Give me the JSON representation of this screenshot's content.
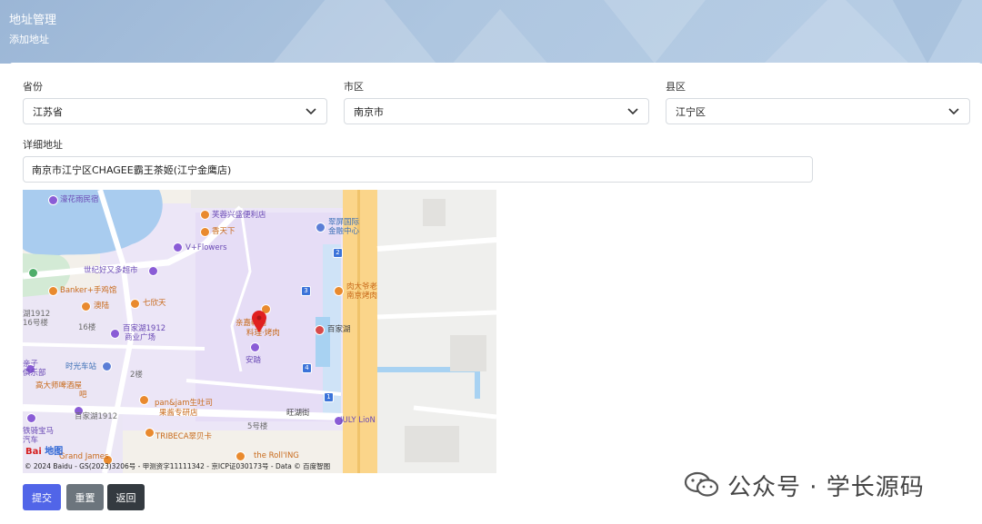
{
  "header": {
    "title": "地址管理",
    "subtitle": "添加地址"
  },
  "form": {
    "province": {
      "label": "省份",
      "value": "江苏省"
    },
    "city": {
      "label": "市区",
      "value": "南京市"
    },
    "district": {
      "label": "县区",
      "value": "江宁区"
    },
    "detail": {
      "label": "详细地址",
      "value": "南京市江宁区CHAGEE霸王茶姬(江宁金鹰店)"
    }
  },
  "map": {
    "copyright": "© 2024 Baidu - GS(2023)3206号 - 甲测资字11111342 - 京ICP证030173号 - Data © 百度智图",
    "logo_text": "Bai",
    "logo_suffix": "地图",
    "labels": {
      "l1": "濠花雨民宿",
      "l2": "芙蓉兴盛便利店",
      "l3": "翠屏国际",
      "l4": "金融中心",
      "l5": "香天下",
      "l6": "V+Flowers",
      "l7": "世纪好又多超市",
      "l8": "Banker+手鸡馆",
      "l9": "七欣天",
      "l10": "肉大爷老",
      "l11": "南京烤肉",
      "l12": "湖1912",
      "l13": "16号楼",
      "l14": "澳陆",
      "l15": "16楼",
      "l16": "百家湖1912",
      "l17": "商业广场",
      "l18": "亲嘉韩国",
      "l19": "料理·烤肉",
      "l20": "百家湖",
      "l21": "安踏",
      "l22": "亲子",
      "l23": "俱乐部",
      "l24": "时光车站",
      "l25": "2楼",
      "l26": "高大师啤酒屋",
      "l27": "吧",
      "l28": "pan&jam生吐司",
      "l29": "果酱专研店",
      "l30": "百家湖1912",
      "l31": "旺湖街",
      "l32": "5号楼",
      "l33": "JULY LioN",
      "l34": "铁骑宝马",
      "l35": "汽车",
      "l36": "TRIBECA翠贝卡",
      "l37": "the Roll'ING",
      "l38": "Grand James",
      "s2": "2",
      "s3": "3",
      "s4": "4",
      "s1": "1"
    }
  },
  "buttons": {
    "submit": "提交",
    "reset": "重置",
    "back": "返回"
  },
  "watermark": {
    "text": "公众号 · 学长源码"
  },
  "colors": {
    "submit": "#5165e8",
    "reset": "#6c757d",
    "back": "#343a40",
    "banner": "#a8c2de",
    "marker": "#e02020"
  }
}
